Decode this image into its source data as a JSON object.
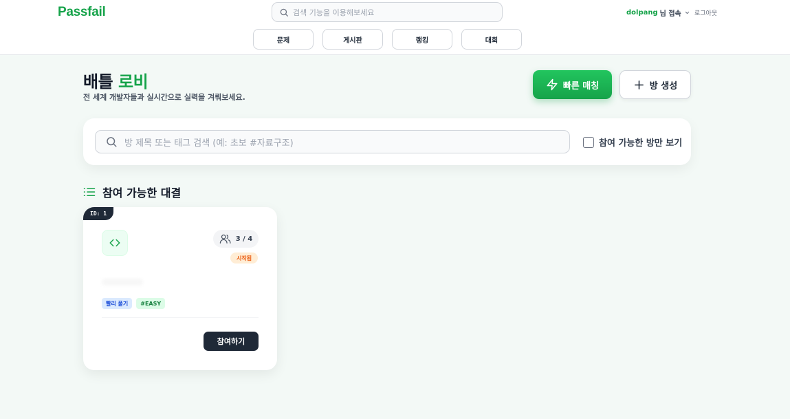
{
  "header": {
    "logo": "Passfail",
    "search_placeholder": "검색 기능을 이용해보세요",
    "user_name": "dolpang",
    "user_suffix": "님 접속",
    "logout": "로그아웃",
    "nav": [
      "문제",
      "게시판",
      "랭킹",
      "대회"
    ]
  },
  "lobby": {
    "title_main": "배틀",
    "title_accent": "로비",
    "subtitle": "전 세계 개발자들과 실시간으로 실력을 겨뤄보세요.",
    "quick_match_label": "빠른 매칭",
    "create_room_label": "방 생성",
    "search_placeholder": "방 제목 또는 태그 검색 (예: 초보 #자료구조)",
    "only_open_label": "참여 가능한 방만 보기",
    "section_title": "참여 가능한 대결"
  },
  "rooms": [
    {
      "id_label": "ID: 1",
      "players": "3 / 4",
      "status": "시작됨",
      "tags": [
        "빨리 풀기",
        "#EASY"
      ],
      "join_label": "참여하기"
    }
  ],
  "colors": {
    "brand": "#16a34a",
    "background": "#f3f9f6",
    "dark": "#1f2937"
  },
  "icons": {
    "search": "search-icon",
    "bolt": "bolt-icon",
    "plus": "plus-icon",
    "list": "list-icon",
    "code": "code-icon",
    "users": "users-icon",
    "chevron": "chevron-down-icon"
  }
}
